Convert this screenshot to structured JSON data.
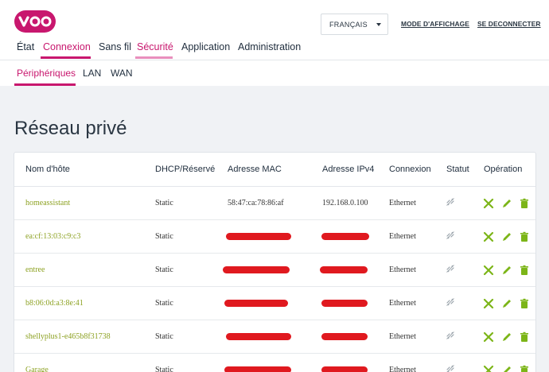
{
  "header": {
    "brand": "VOO",
    "language": "FRANÇAIS",
    "display_mode_link": "MODE D'AFFICHAGE",
    "logout_link": "SE DECONNECTER"
  },
  "nav": {
    "items": [
      {
        "label": "État"
      },
      {
        "label": "Connexion"
      },
      {
        "label": "Sans fil"
      },
      {
        "label": "Sécurité"
      },
      {
        "label": "Application"
      },
      {
        "label": "Administration"
      }
    ],
    "active": "Connexion"
  },
  "subnav": {
    "items": [
      {
        "label": "Périphériques"
      },
      {
        "label": "LAN"
      },
      {
        "label": "WAN"
      }
    ],
    "active": "Périphériques"
  },
  "page": {
    "title": "Réseau privé"
  },
  "table": {
    "headers": [
      "Nom d'hôte",
      "DHCP/Réservé",
      "Adresse MAC",
      "Adresse IPv4",
      "Connexion",
      "Statut",
      "Opération"
    ],
    "rows": [
      {
        "host": "homeassistant",
        "dhcp": "Static",
        "mac": "58:47:ca:78:86:af",
        "ip": "192.168.0.100",
        "connection": "Ethernet",
        "mac_redacted": false,
        "ip_redacted": false
      },
      {
        "host": "ea:cf:13:03:c9:c3",
        "dhcp": "Static",
        "mac": "",
        "ip": "",
        "connection": "Ethernet",
        "mac_redacted": true,
        "ip_redacted": true
      },
      {
        "host": "entree",
        "dhcp": "Static",
        "mac": "",
        "ip": "",
        "connection": "Ethernet",
        "mac_redacted": true,
        "ip_redacted": true
      },
      {
        "host": "b8:06:0d:a3:8e:41",
        "dhcp": "Static",
        "mac": "",
        "ip": "",
        "connection": "Ethernet",
        "mac_redacted": true,
        "ip_redacted": true
      },
      {
        "host": "shellyplus1-e465b8f31738",
        "dhcp": "Static",
        "mac": "",
        "ip": "",
        "connection": "Ethernet",
        "mac_redacted": true,
        "ip_redacted": true
      },
      {
        "host": "Garage",
        "dhcp": "Static",
        "mac": "",
        "ip": "",
        "connection": "Ethernet",
        "mac_redacted": true,
        "ip_redacted": true
      }
    ],
    "status_icon": "disconnected-link-icon",
    "operation_icons": [
      "delete-x-icon",
      "edit-pencil-icon",
      "trash-icon"
    ]
  },
  "colors": {
    "accent": "#c8176e",
    "nav_security_underline": "#e98fbd",
    "host_text": "#8da223",
    "op_icon": "#7cb518",
    "redaction": "#e0191f",
    "background": "#f0f2f5"
  }
}
